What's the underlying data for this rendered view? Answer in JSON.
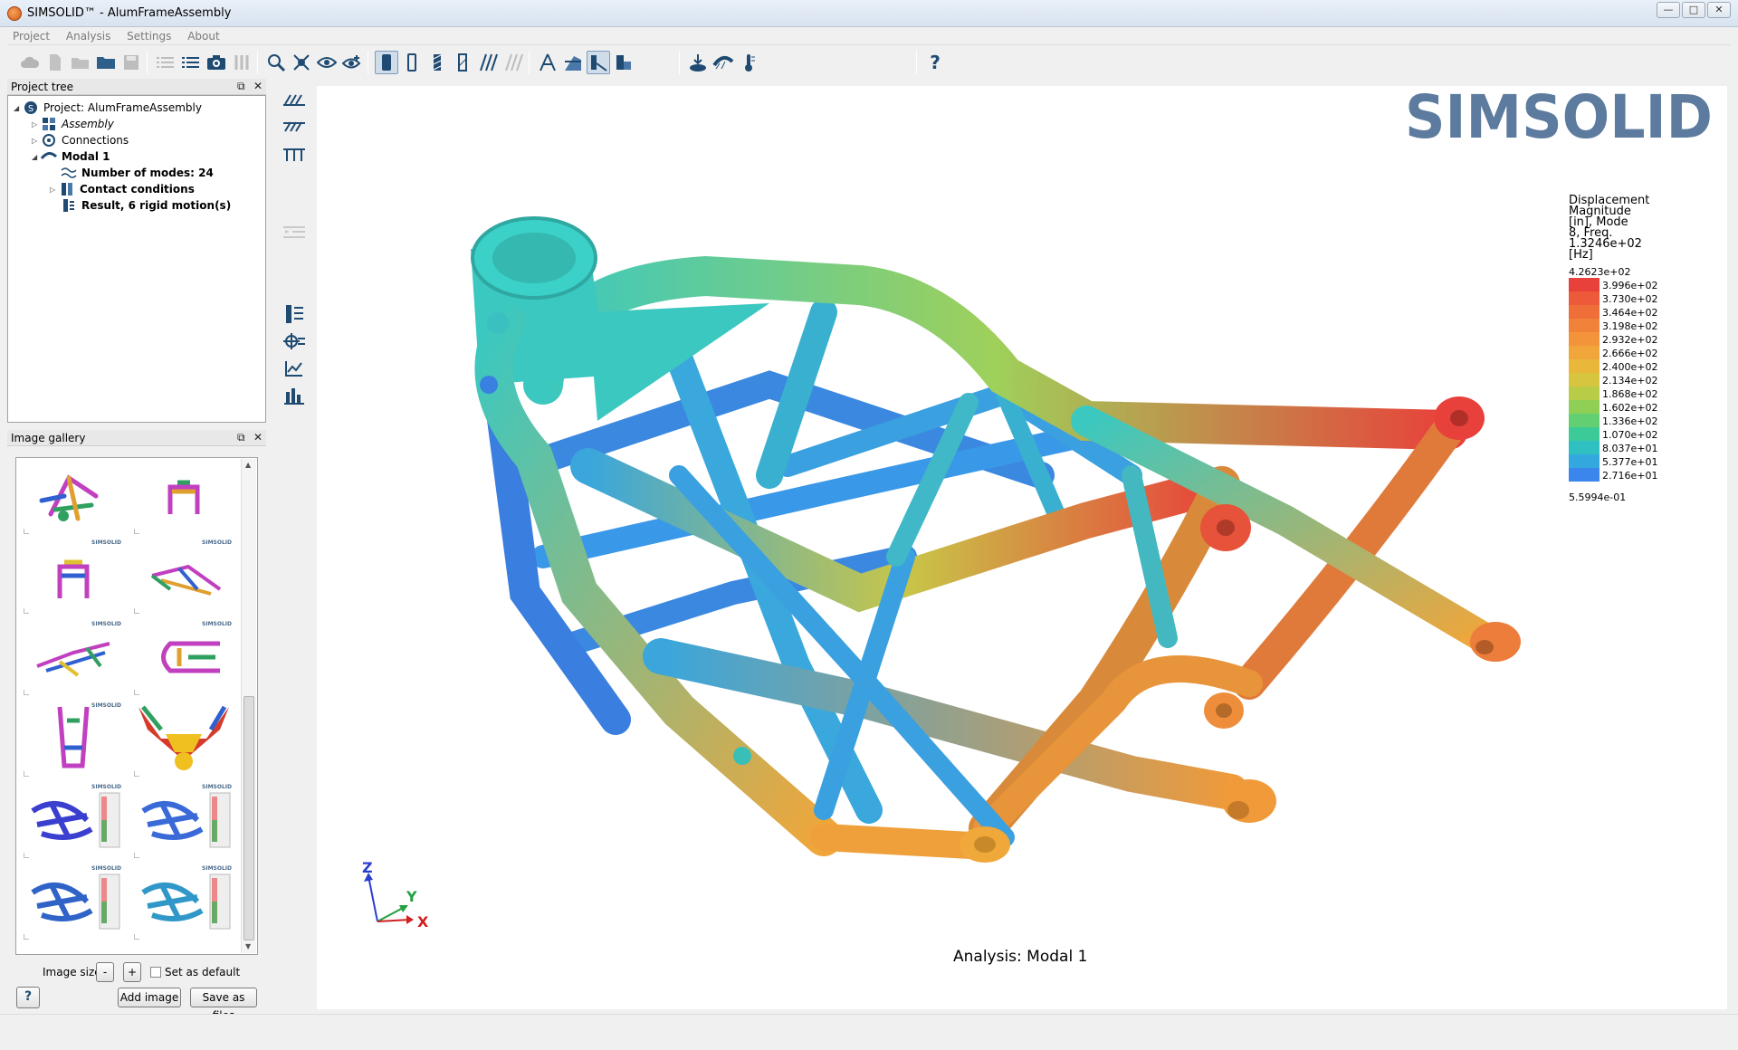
{
  "window": {
    "title": "SIMSOLID™ -  AlumFrameAssembly"
  },
  "menu": [
    "Project",
    "Analysis",
    "Settings",
    "About"
  ],
  "project_tree": {
    "header": "Project tree",
    "items": [
      {
        "label": "Project: AlumFrameAssembly",
        "icon": "project-icon"
      },
      {
        "label": "Assembly",
        "icon": "assembly-icon"
      },
      {
        "label": "Connections",
        "icon": "connections-icon"
      },
      {
        "label": "Modal 1",
        "icon": "modal-icon"
      },
      {
        "label": "Number of modes: 24",
        "icon": "modes-icon"
      },
      {
        "label": "Contact conditions",
        "icon": "contact-icon"
      },
      {
        "label": "Result, 6 rigid motion(s)",
        "icon": "result-icon"
      }
    ]
  },
  "gallery": {
    "header": "Image gallery",
    "watermark": "SIMSOLID",
    "image_size_label": "Image size",
    "minus_label": "-",
    "plus_label": "+",
    "set_default_label": "Set as default",
    "add_image_label": "Add image",
    "save_files_label": "Save as files",
    "help_label": "?"
  },
  "viewport": {
    "logo_text": "SIMSOLID",
    "analysis_label": "Analysis: Modal 1",
    "axis": {
      "z": "Z",
      "y": "Y",
      "x": "X"
    }
  },
  "legend": {
    "title_lines": [
      "Displacement",
      "Magnitude",
      "[in], Mode",
      "8, Freq.",
      "1.3246e+02",
      "[Hz]"
    ],
    "max": "4.2623e+02",
    "min": "5.5994e-01",
    "entries": [
      {
        "label": "3.996e+02",
        "color": "#e8413b"
      },
      {
        "label": "3.730e+02",
        "color": "#ec5a3a"
      },
      {
        "label": "3.464e+02",
        "color": "#ef6e3a"
      },
      {
        "label": "3.198e+02",
        "color": "#f1823a"
      },
      {
        "label": "2.932e+02",
        "color": "#f3943a"
      },
      {
        "label": "2.666e+02",
        "color": "#f0a63a"
      },
      {
        "label": "2.400e+02",
        "color": "#e9b83b"
      },
      {
        "label": "2.134e+02",
        "color": "#d8c53f"
      },
      {
        "label": "1.868e+02",
        "color": "#b9cc47"
      },
      {
        "label": "1.602e+02",
        "color": "#8fcf55"
      },
      {
        "label": "1.336e+02",
        "color": "#62cf73"
      },
      {
        "label": "1.070e+02",
        "color": "#3ccb98"
      },
      {
        "label": "8.037e+01",
        "color": "#2fc0c1"
      },
      {
        "label": "5.377e+01",
        "color": "#33a8de"
      },
      {
        "label": "2.716e+01",
        "color": "#3b86ec"
      }
    ]
  },
  "toolbar": {
    "help_label": "?"
  }
}
